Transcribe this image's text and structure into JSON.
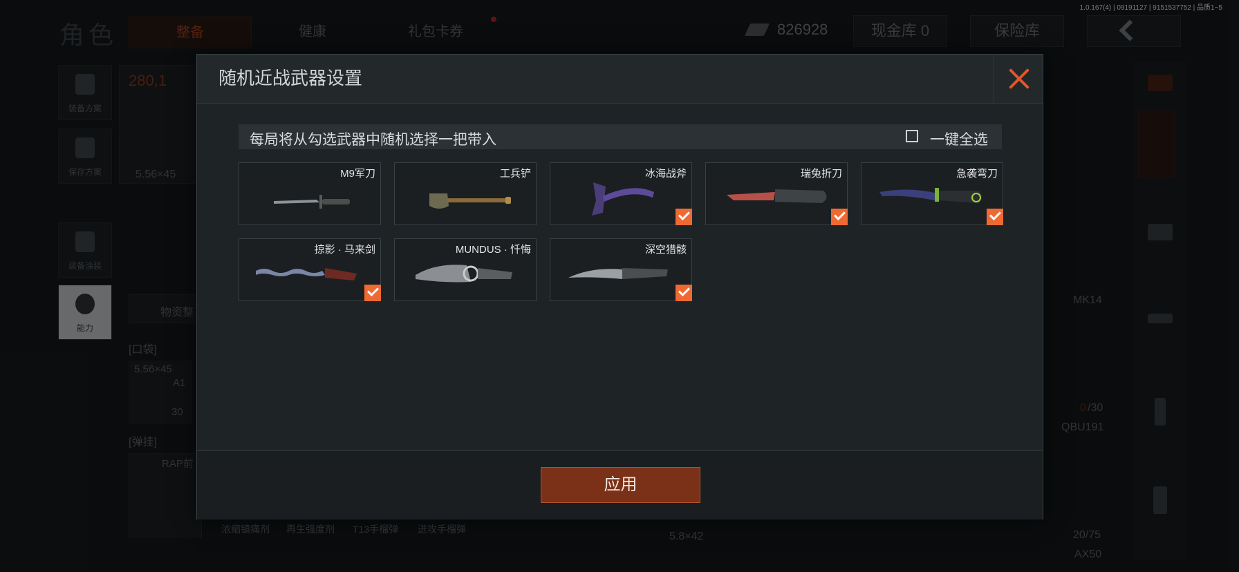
{
  "version_text": "1.0.167(4) | 09191127 | 9151537752 | 品质1~5",
  "background": {
    "page_title": "角色",
    "tabs": [
      "整备",
      "健康",
      "礼包卡券"
    ],
    "currency_value": "826928",
    "cash_vault": "现金库 0",
    "safe_box": "保险库",
    "left_nav": [
      "装备方案",
      "保存方案",
      "装备涂装",
      "能力"
    ],
    "weight_value": "280,1",
    "ammo_type": "5.56×45",
    "supplies_tab": "物资整",
    "pocket_label": "[口袋]",
    "pocket_item_caliber": "5.56×45",
    "pocket_item_grade": "A1",
    "pocket_item_count": "30",
    "rig_label": "[弹挂]",
    "rig_item": "RAP前",
    "quick_items": [
      "浓缩镇痛剂",
      "再生强度剂",
      "T13手榴弹",
      "进攻手榴弹"
    ],
    "weapon_1": "MK14",
    "ammo_count_1_loaded": "0",
    "ammo_count_1_total": "/30",
    "weapon_2": "QBU191",
    "caliber_2": "5.8×42",
    "ammo_count_2": "20/75",
    "weapon_3": "AX50"
  },
  "modal": {
    "title": "随机近战武器设置",
    "info_text": "每局将从勾选武器中随机选择一把带入",
    "select_all_label": "一键全选",
    "select_all_checked": false,
    "apply_label": "应用",
    "accent_color": "#ee6a32",
    "weapons": [
      {
        "name": "M9军刀",
        "checked": false,
        "icon": "bayonet-knife-icon"
      },
      {
        "name": "工兵铲",
        "checked": false,
        "icon": "shovel-icon"
      },
      {
        "name": "冰海战斧",
        "checked": true,
        "icon": "battle-axe-icon"
      },
      {
        "name": "瑞兔折刀",
        "checked": true,
        "icon": "folding-knife-icon"
      },
      {
        "name": "急袭弯刀",
        "checked": true,
        "icon": "karambit-icon"
      },
      {
        "name": "掠影 · 马来剑",
        "checked": true,
        "icon": "kris-sword-icon"
      },
      {
        "name": "MUNDUS · 忏悔",
        "checked": false,
        "icon": "ornate-blade-icon"
      },
      {
        "name": "深空猎骸",
        "checked": true,
        "icon": "hunting-blade-icon"
      }
    ]
  }
}
